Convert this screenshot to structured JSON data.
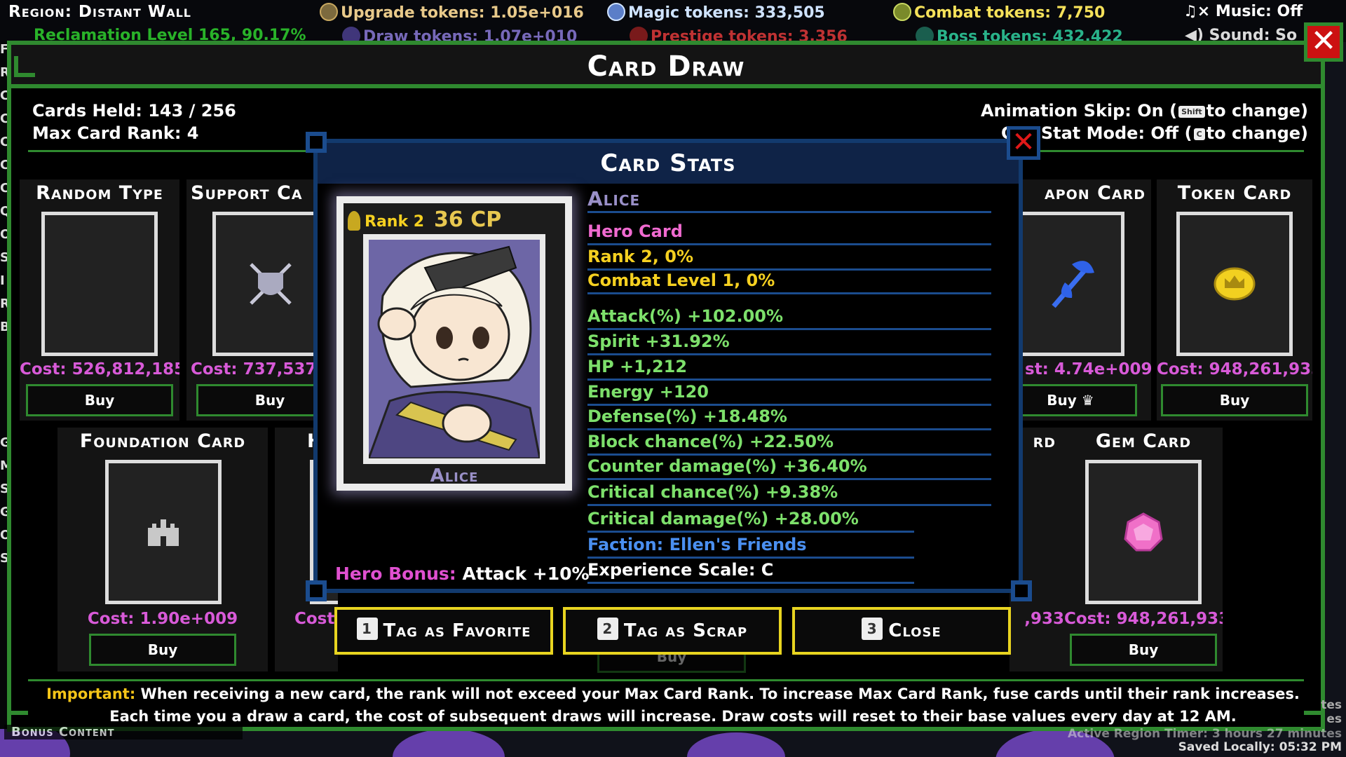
{
  "topbar": {
    "region": "Region: Distant Wall",
    "reclamation": "Reclamation Level 165, 90.17%",
    "upgrade_tokens": "Upgrade tokens: 1.05e+016",
    "draw_tokens": "Draw tokens: 1.07e+010",
    "magic_tokens": "Magic tokens: 333,505",
    "prestige_tokens": "Prestige tokens: 3,356",
    "combat_tokens": "Combat tokens: 7,750",
    "boss_tokens": "Boss tokens: 432,422",
    "music": "Music: Off",
    "sound": "Sound: So"
  },
  "left_letters": [
    "F",
    "R",
    "C",
    "C",
    "C",
    "C",
    "C",
    "Q",
    "O",
    "S",
    "I",
    "R",
    "B",
    "",
    "",
    "",
    "",
    "G",
    "M",
    "S",
    "G",
    "O",
    "S"
  ],
  "panel": {
    "title": "Card Draw",
    "cards_held": "Cards Held: 143 / 256",
    "max_card_rank": "Max Card Rank: 4",
    "animation_skip_pre": "Animation Skip: On (",
    "animation_skip_key": "Shift",
    "animation_skip_post": "to change)",
    "stat_mode_pre": "Stat Mode: Off (",
    "stat_mode_key": "C",
    "stat_mode_post": "to change)",
    "stat_mode_fragment": "C"
  },
  "slots": {
    "random": {
      "title": "Random Type",
      "cost": "Cost: 526,812,185",
      "buy": "Buy"
    },
    "support": {
      "title": "Support Ca",
      "cost": "Cost: 737,537,",
      "buy": "Buy"
    },
    "weapon": {
      "title": "apon Card",
      "cost": "st: 4.74e+009",
      "buy": "Buy"
    },
    "token": {
      "title": "Token Card",
      "cost": "Cost: 948,261,933",
      "buy": "Buy"
    },
    "foundation": {
      "title": "Foundation Card",
      "cost": "Cost: 1.90e+009",
      "buy": "Buy"
    },
    "hidden_a": {
      "title": "H",
      "cost": "Cost"
    },
    "hidden_b": {
      "title": "rd",
      "cost": ",933"
    },
    "hidden_center": {
      "buy": "Buy"
    },
    "gem": {
      "title": "Gem Card",
      "cost": "Cost: 948,261,933",
      "buy": "Buy"
    }
  },
  "modal": {
    "title": "Card Stats",
    "card": {
      "rank": "Rank 2",
      "cp": "36 CP",
      "name": "Alice"
    },
    "stats": {
      "name": "Alice",
      "type": "Hero Card",
      "rank": "Rank 2, 0%",
      "combat_level": "Combat Level 1, 0%",
      "attack": "Attack(%) +102.00%",
      "spirit": "Spirit +31.92%",
      "hp": "HP +1,212",
      "energy": "Energy +120",
      "defense": "Defense(%) +18.48%",
      "block": "Block chance(%) +22.50%",
      "counter": "Counter damage(%) +36.40%",
      "crit_chance": "Critical chance(%) +9.38%",
      "crit_damage": "Critical damage(%) +28.00%",
      "faction": "Faction: Ellen's Friends",
      "exp_scale": "Experience Scale: C"
    },
    "hero_bonus_label": "Hero Bonus:",
    "hero_bonus_value": "Attack +10%",
    "buttons": {
      "favorite": {
        "num": "1",
        "label": "Tag as Favorite"
      },
      "scrap": {
        "num": "2",
        "label": "Tag as Scrap"
      },
      "close": {
        "num": "3",
        "label": "Close"
      }
    }
  },
  "important": {
    "label": "Important:",
    "line1": "When receiving a new card, the rank will not exceed your Max Card Rank. To increase Max Card Rank, fuse cards until their rank increases.",
    "line2": "Each time you a draw a card, the cost of subsequent draws will increase. Draw costs will reset to their base values every day at 12 AM."
  },
  "footer": {
    "bonus_content": "Bonus Content",
    "active_region": "Active Region Timer: 3 hours 27 minutes",
    "saved": "Saved Locally: 05:32 PM",
    "side_fragment_1": "tes",
    "side_fragment_2": "es"
  },
  "colors": {
    "panel_border": "#2f8a2f",
    "modal_border": "#123a6e",
    "cost": "#d85ad8",
    "hero_card": "#f06ad0",
    "rank": "#f5d020",
    "stat_green": "#7de06b",
    "faction": "#4a8ff0",
    "button_border": "#e8d420"
  }
}
